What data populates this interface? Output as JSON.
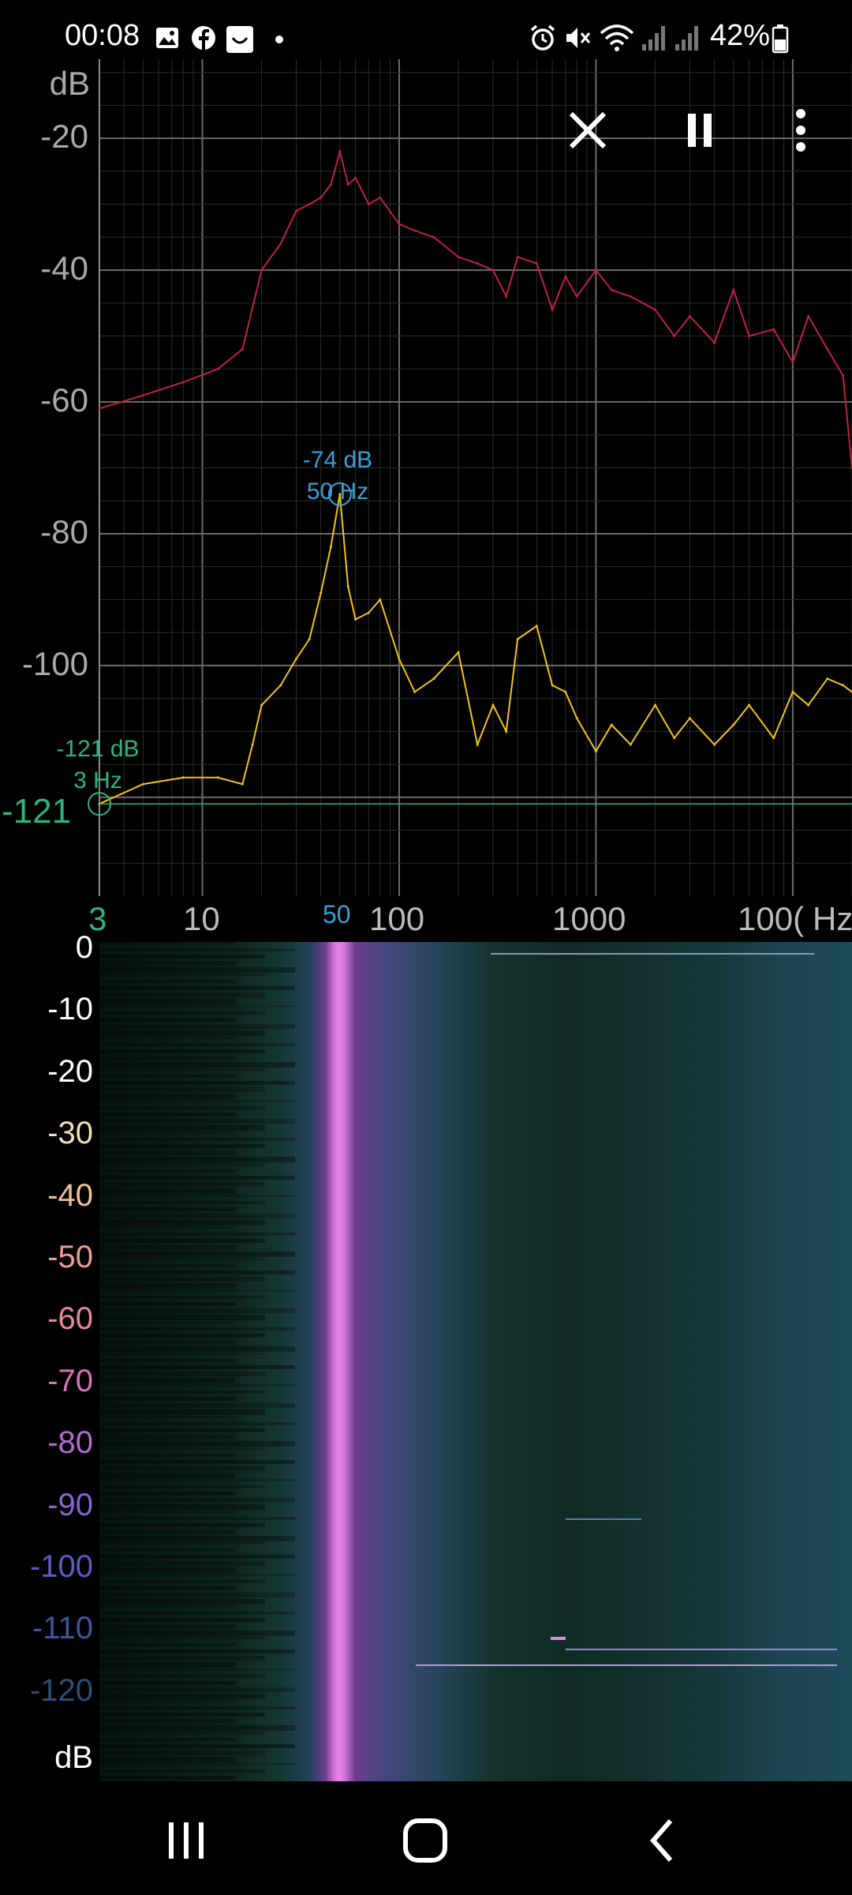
{
  "status_bar": {
    "time": "00:08",
    "battery": "42%",
    "left_icons": [
      "gallery-icon",
      "facebook-icon",
      "app-icon",
      "dot-icon"
    ],
    "right_icons": [
      "alarm-icon",
      "mute-icon",
      "wifi-icon",
      "signal-icon",
      "signal-icon",
      "battery-icon"
    ]
  },
  "toolbar": {
    "close": "close-icon",
    "pause": "pause-icon",
    "menu": "more-vert-icon"
  },
  "spectrum": {
    "y_unit": "dB",
    "y_ticks": [
      "-20",
      "-40",
      "-60",
      "-80",
      "-100"
    ],
    "x_ticks": [
      "10",
      "100",
      "1000"
    ],
    "x_tick_partial": "100(",
    "x_unit": "Hz",
    "peak_marker": {
      "db": "-74 dB",
      "hz": "50 Hz",
      "x_label": "50",
      "color": "#3b9fd6"
    },
    "cursor_marker": {
      "db": "-121 dB",
      "hz": "3 Hz",
      "y_label": "-121",
      "x_label": "3",
      "color": "#2fb57a"
    }
  },
  "chart_data": {
    "type": "line",
    "xscale": "log",
    "xlim": [
      3,
      20000
    ],
    "ylim": [
      -135,
      -8
    ],
    "ylabel": "dB",
    "xlabel": "Hz",
    "series": [
      {
        "color": "#c0213f",
        "x": [
          3,
          5,
          8,
          12,
          16,
          20,
          25,
          30,
          35,
          40,
          45,
          50,
          55,
          60,
          70,
          80,
          100,
          120,
          150,
          200,
          250,
          300,
          350,
          400,
          500,
          600,
          700,
          800,
          1000,
          1200,
          1500,
          2000,
          2500,
          3000,
          4000,
          5000,
          6000,
          8000,
          10000,
          12000,
          15000,
          18000,
          20000
        ],
        "y": [
          -61,
          -59,
          -57,
          -55,
          -52,
          -40,
          -36,
          -31,
          -30,
          -29,
          -27,
          -22,
          -27,
          -26,
          -30,
          -29,
          -33,
          -34,
          -35,
          -38,
          -39,
          -40,
          -44,
          -38,
          -39,
          -46,
          -41,
          -44,
          -40,
          -43,
          -44,
          -46,
          -50,
          -47,
          -51,
          -43,
          -50,
          -49,
          -54,
          -47,
          -52,
          -56,
          -70
        ]
      },
      {
        "color": "#f2c418",
        "x": [
          3,
          5,
          8,
          12,
          16,
          18,
          20,
          25,
          30,
          35,
          40,
          45,
          50,
          55,
          60,
          70,
          80,
          100,
          120,
          150,
          200,
          250,
          300,
          350,
          400,
          500,
          600,
          700,
          800,
          1000,
          1200,
          1500,
          2000,
          2500,
          3000,
          4000,
          5000,
          6000,
          8000,
          10000,
          12000,
          15000,
          18000,
          20000
        ],
        "y": [
          -121,
          -118,
          -117,
          -117,
          -118,
          -112,
          -106,
          -103,
          -99,
          -96,
          -89,
          -82,
          -74,
          -88,
          -93,
          -92,
          -90,
          -99,
          -104,
          -102,
          -98,
          -112,
          -106,
          -110,
          -96,
          -94,
          -103,
          -104,
          -108,
          -113,
          -109,
          -112,
          -106,
          -111,
          -108,
          -112,
          -109,
          -106,
          -111,
          -104,
          -106,
          -102,
          -103,
          -104
        ]
      }
    ]
  },
  "spectrogram": {
    "y_ticks": [
      {
        "label": "0",
        "color": "#ffffff"
      },
      {
        "label": "-10",
        "color": "#ffffff"
      },
      {
        "label": "-20",
        "color": "#ffffff"
      },
      {
        "label": "-30",
        "color": "#f1dfb4"
      },
      {
        "label": "-40",
        "color": "#f2c19a"
      },
      {
        "label": "-50",
        "color": "#ec9b92"
      },
      {
        "label": "-60",
        "color": "#e68a9c"
      },
      {
        "label": "-70",
        "color": "#d574b6"
      },
      {
        "label": "-80",
        "color": "#b36bd0"
      },
      {
        "label": "-90",
        "color": "#8a63d4"
      },
      {
        "label": "-100",
        "color": "#5e5cc4"
      },
      {
        "label": "-110",
        "color": "#3e55a0"
      },
      {
        "label": "-120",
        "color": "#2e4e74"
      }
    ],
    "unit": "dB"
  },
  "nav_bar": {
    "recents": "recents-icon",
    "home": "home-icon",
    "back": "back-icon"
  }
}
